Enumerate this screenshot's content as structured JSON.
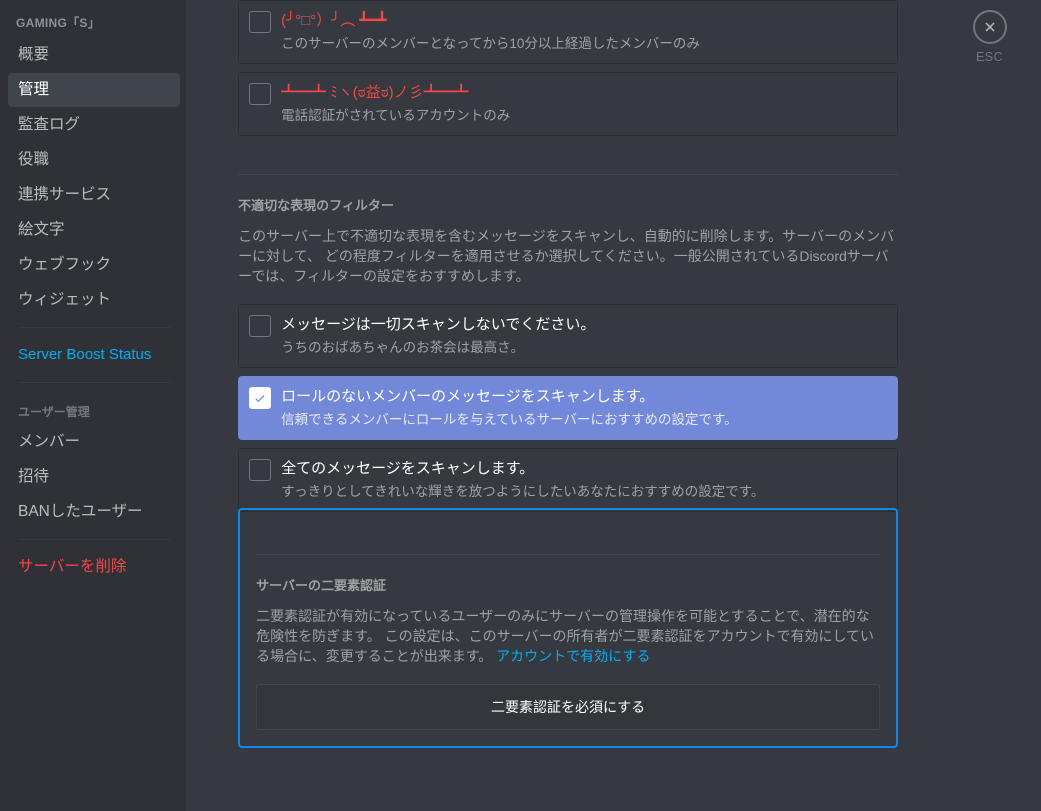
{
  "sidebar": {
    "header": "GAMING「S」",
    "items": [
      {
        "label": "概要",
        "selected": false
      },
      {
        "label": "管理",
        "selected": true
      },
      {
        "label": "監査ログ",
        "selected": false
      },
      {
        "label": "役職",
        "selected": false
      },
      {
        "label": "連携サービス",
        "selected": false
      },
      {
        "label": "絵文字",
        "selected": false
      },
      {
        "label": "ウェブフック",
        "selected": false
      },
      {
        "label": "ウィジェット",
        "selected": false
      }
    ],
    "boost_link": "Server Boost Status",
    "user_mgmt_header": "ユーザー管理",
    "user_mgmt_items": [
      {
        "label": "メンバー"
      },
      {
        "label": "招待"
      },
      {
        "label": "BANしたユーザー"
      }
    ],
    "delete_server": "サーバーを削除"
  },
  "verification": {
    "options": [
      {
        "title": "(╯°□°）╯︵ ┻━┻",
        "desc": "このサーバーのメンバーとなってから10分以上経過したメンバーのみ",
        "kind": "emoji"
      },
      {
        "title": "┻━┻ ﾐヽ(ಠ益ಠ)ノ彡┻━┻",
        "desc": "電話認証がされているアカウントのみ",
        "kind": "emoji"
      }
    ]
  },
  "filter": {
    "title": "不適切な表現のフィルター",
    "body": "このサーバー上で不適切な表現を含むメッセージをスキャンし、自動的に削除します。サーバーのメンバーに対して、 どの程度フィルターを適用させるか選択してください。一般公開されているDiscordサーバーでは、フィルターの設定をおすすめします。",
    "options": [
      {
        "title": "メッセージは一切スキャンしないでください。",
        "desc": "うちのおばあちゃんのお茶会は最高さ。",
        "selected": false
      },
      {
        "title": "ロールのないメンバーのメッセージをスキャンします。",
        "desc": "信頼できるメンバーにロールを与えているサーバーにおすすめの設定です。",
        "selected": true
      },
      {
        "title": "全てのメッセージをスキャンします。",
        "desc": "すっきりとしてきれいな輝きを放つようにしたいあなたにおすすめの設定です。",
        "selected": false
      }
    ]
  },
  "twofa": {
    "title": "サーバーの二要素認証",
    "body_prefix": "二要素認証が有効になっているユーザーのみにサーバーの管理操作を可能とすることで、潜在的な危険性を防ぎます。 この設定は、このサーバーの所有者が二要素認証をアカウントで有効にしている場合に、変更することが出来ます。 ",
    "body_link": "アカウントで有効にする",
    "button": "二要素認証を必須にする"
  },
  "close": {
    "label": "ESC"
  }
}
